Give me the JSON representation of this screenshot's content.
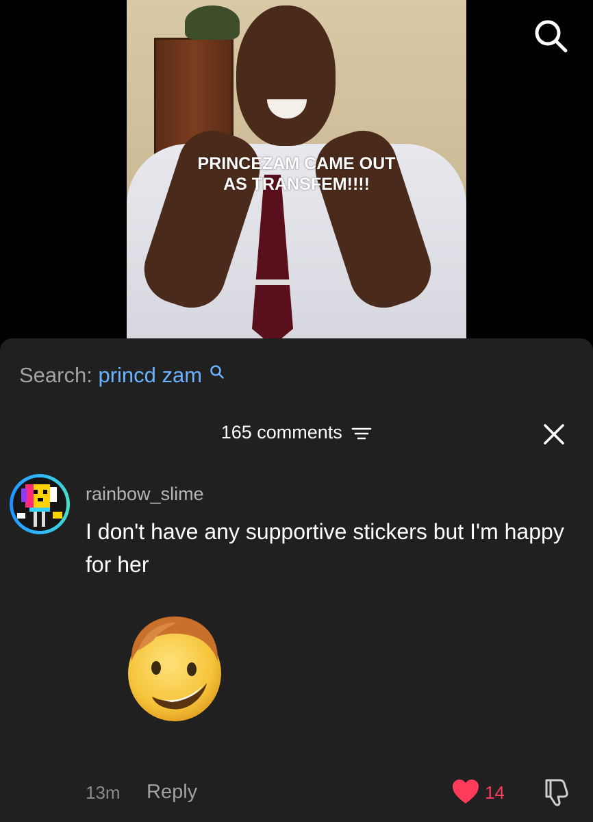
{
  "video": {
    "caption_line1": "PRINCEZAM CAME OUT",
    "caption_line2": "AS TRANSFEM!!!!"
  },
  "top_icons": {
    "search_icon": "search-icon"
  },
  "related_search": {
    "label": "Search:",
    "term": "princd zam",
    "term_color": "#6ab4ff"
  },
  "comments_header": {
    "count_label": "165 comments",
    "filter_icon": "filter-icon",
    "close_icon": "close-icon"
  },
  "comment": {
    "username": "rainbow_slime",
    "text": "I don't have any supportive stickers but I'm happy for her",
    "sticker": "smirking-face-sticker",
    "time": "13m",
    "reply_label": "Reply",
    "likes": "14",
    "like_color": "#ff3b5c"
  }
}
